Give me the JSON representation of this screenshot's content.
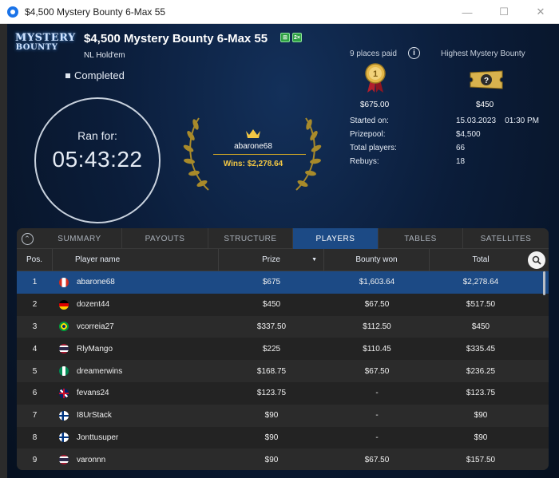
{
  "window": {
    "title": "$4,500 Mystery Bounty 6-Max 55",
    "minimize": "—",
    "maximize": "☐",
    "close": "✕"
  },
  "header": {
    "logo_line1": "MYSTERY",
    "logo_line2": "BOUNTY",
    "title": "$4,500 Mystery Bounty 6-Max 55",
    "badge1": "⊞",
    "badge2": "2×",
    "game_type": "NL Hold'em",
    "status": "Completed"
  },
  "timer": {
    "label": "Ran for:",
    "value": "05:43:22"
  },
  "winner": {
    "name": "abarone68",
    "wins": "Wins: $2,278.64"
  },
  "payout_info": {
    "places_paid": "9 places paid",
    "highest_label": "Highest Mystery Bounty",
    "first_prize": "$675.00",
    "highest_bounty": "$450",
    "medal_label": "1",
    "ticket_label": "?"
  },
  "details": [
    {
      "key": "Started on:",
      "value": "15.03.2023    01:30 PM"
    },
    {
      "key": "Prizepool:",
      "value": "$4,500"
    },
    {
      "key": "Total players:",
      "value": "66"
    },
    {
      "key": "Rebuys:",
      "value": "18"
    }
  ],
  "tabs": [
    "SUMMARY",
    "PAYOUTS",
    "STRUCTURE",
    "PLAYERS",
    "TABLES",
    "SATELLITES"
  ],
  "active_tab": "PLAYERS",
  "columns": [
    "Pos.",
    "Player name",
    "Prize",
    "Bounty won",
    "Total"
  ],
  "rows": [
    {
      "pos": "1",
      "name": "abarone68",
      "flag": "ca",
      "prize": "$675",
      "bounty": "$1,603.64",
      "total": "$2,278.64"
    },
    {
      "pos": "2",
      "name": "dozent44",
      "flag": "de",
      "prize": "$450",
      "bounty": "$67.50",
      "total": "$517.50"
    },
    {
      "pos": "3",
      "name": "vcorreia27",
      "flag": "br",
      "prize": "$337.50",
      "bounty": "$112.50",
      "total": "$450"
    },
    {
      "pos": "4",
      "name": "RlyMango",
      "flag": "th",
      "prize": "$225",
      "bounty": "$110.45",
      "total": "$335.45"
    },
    {
      "pos": "5",
      "name": "dreamerwins",
      "flag": "ng",
      "prize": "$168.75",
      "bounty": "$67.50",
      "total": "$236.25"
    },
    {
      "pos": "6",
      "name": "fevans24",
      "flag": "gb",
      "prize": "$123.75",
      "bounty": "-",
      "total": "$123.75"
    },
    {
      "pos": "7",
      "name": "I8UrStack",
      "flag": "fi",
      "prize": "$90",
      "bounty": "-",
      "total": "$90"
    },
    {
      "pos": "8",
      "name": "Jonttusuper",
      "flag": "fi",
      "prize": "$90",
      "bounty": "-",
      "total": "$90"
    },
    {
      "pos": "9",
      "name": "varonnn",
      "flag": "th",
      "prize": "$90",
      "bounty": "$67.50",
      "total": "$157.50"
    }
  ],
  "colors": {
    "accent": "#1c4a85",
    "gold": "#f2c744",
    "background": "#0b1d3a"
  }
}
